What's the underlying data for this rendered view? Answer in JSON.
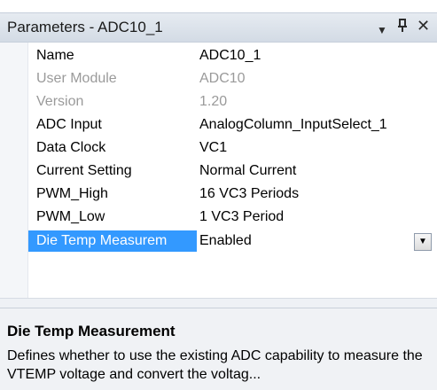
{
  "panel": {
    "title": "Parameters - ADC10_1",
    "icons": {
      "dropdown": "▾",
      "pin": "pin-icon",
      "close": "close-icon"
    }
  },
  "properties": [
    {
      "name": "Name",
      "value": "ADC10_1",
      "disabled": false
    },
    {
      "name": "User Module",
      "value": "ADC10",
      "disabled": true
    },
    {
      "name": "Version",
      "value": "1.20",
      "disabled": true
    },
    {
      "name": "ADC Input",
      "value": "AnalogColumn_InputSelect_1",
      "disabled": false
    },
    {
      "name": "Data Clock",
      "value": "VC1",
      "disabled": false
    },
    {
      "name": "Current Setting",
      "value": "Normal Current",
      "disabled": false
    },
    {
      "name": "PWM_High",
      "value": "16 VC3 Periods",
      "disabled": false
    },
    {
      "name": "PWM_Low",
      "value": "1 VC3 Period",
      "disabled": false
    },
    {
      "name": "Die Temp Measurem",
      "value": "Enabled",
      "disabled": false,
      "selected": true
    }
  ],
  "description": {
    "title": "Die Temp Measurement",
    "text": "Defines whether to use the existing ADC capability to measure the VTEMP voltage and convert the voltag..."
  },
  "colors": {
    "selection": "#3399ff",
    "disabled_text": "#9a9a9a",
    "titlebar": "#d9e0e9"
  }
}
